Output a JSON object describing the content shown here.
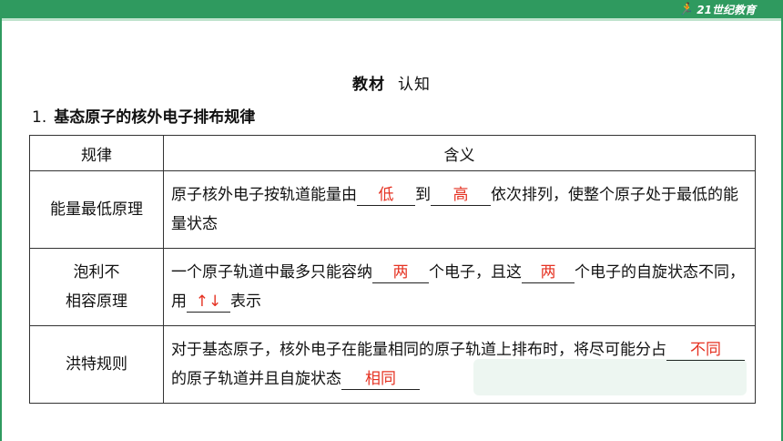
{
  "header": {
    "logo_text": "21世纪教育",
    "accent_color": "#2f9a5f"
  },
  "heading": {
    "main": "教材",
    "sub": "认知"
  },
  "section": {
    "number": "1.",
    "title": "基态原子的核外电子排布规律"
  },
  "table": {
    "headers": [
      "规律",
      "含义"
    ],
    "rows": [
      {
        "name_lines": [
          "能量最低原理"
        ],
        "parts": [
          "原子核外电子按轨道能量由",
          "到",
          "依次排列，使整个原子处于最低的能量状态"
        ],
        "answers": [
          "低",
          "高"
        ]
      },
      {
        "name_lines": [
          "泡利不",
          "相容原理"
        ],
        "parts": [
          "一个原子轨道中最多只能容纳",
          "个电子，且这",
          "个电子的自旋状态不同，用",
          "表示"
        ],
        "answers": [
          "两",
          "两",
          "↑↓"
        ]
      },
      {
        "name_lines": [
          "洪特规则"
        ],
        "parts": [
          "对于基态原子，核外电子在能量相同的原子轨道上排布时，将尽可能分占",
          "的原子轨道并且自旋状态"
        ],
        "answers": [
          "不同",
          "相同"
        ]
      }
    ]
  },
  "answer_color": "#e53222"
}
